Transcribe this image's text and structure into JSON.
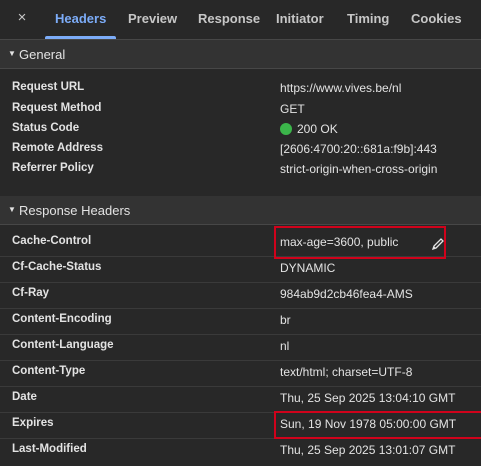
{
  "tabs": {
    "close": "×",
    "items": [
      "Headers",
      "Preview",
      "Response",
      "Initiator",
      "Timing",
      "Cookies"
    ]
  },
  "general": {
    "title": "General",
    "rows": [
      {
        "name": "Request URL",
        "value": "https://www.vives.be/nl"
      },
      {
        "name": "Request Method",
        "value": "GET"
      },
      {
        "name": "Status Code",
        "value": "200 OK"
      },
      {
        "name": "Remote Address",
        "value": "[2606:4700:20::681a:f9b]:443"
      },
      {
        "name": "Referrer Policy",
        "value": "strict-origin-when-cross-origin"
      }
    ]
  },
  "response_headers": {
    "title": "Response Headers",
    "rows": [
      {
        "name": "Cache-Control",
        "value": "max-age=3600, public"
      },
      {
        "name": "Cf-Cache-Status",
        "value": "DYNAMIC"
      },
      {
        "name": "Cf-Ray",
        "value": "984ab9d2cb46fea4-AMS"
      },
      {
        "name": "Content-Encoding",
        "value": "br"
      },
      {
        "name": "Content-Language",
        "value": "nl"
      },
      {
        "name": "Content-Type",
        "value": "text/html; charset=UTF-8"
      },
      {
        "name": "Date",
        "value": "Thu, 25 Sep 2025 13:04:10 GMT"
      },
      {
        "name": "Expires",
        "value": "Sun, 19 Nov 1978 05:00:00 GMT"
      },
      {
        "name": "Last-Modified",
        "value": "Thu, 25 Sep 2025 13:01:07 GMT"
      }
    ]
  },
  "colors": {
    "accent": "#7cacf8",
    "status_ok": "#3bb54a",
    "highlight": "#d0021b"
  },
  "icons": {
    "close": "close-icon",
    "status": "status-ok-dot-icon",
    "edit": "pencil-icon"
  }
}
